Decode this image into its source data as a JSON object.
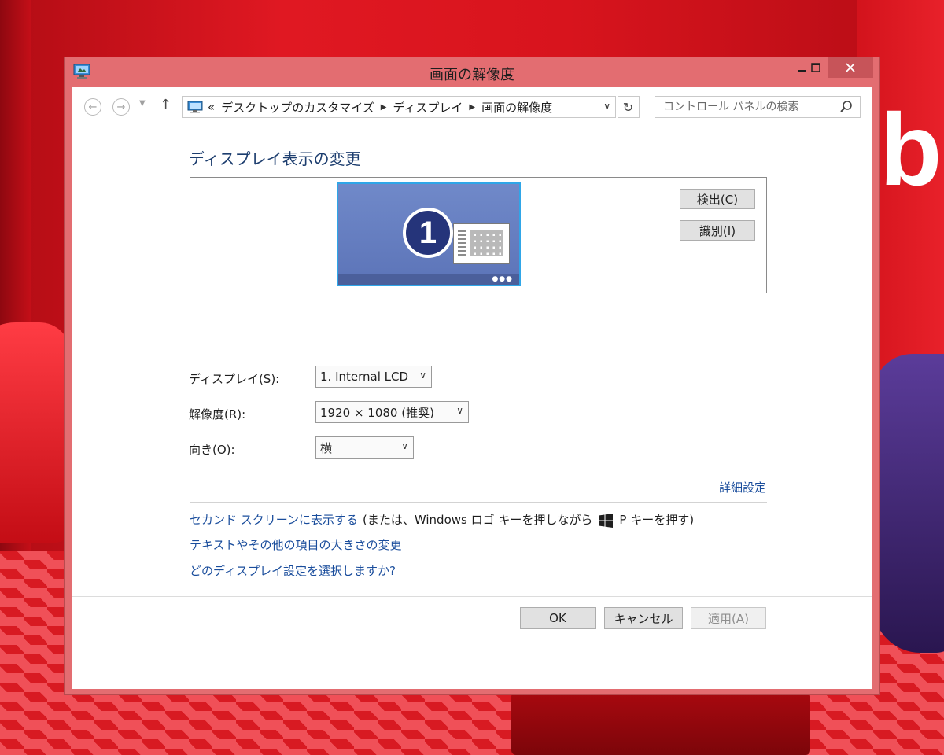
{
  "window": {
    "title": "画面の解像度",
    "controls": {
      "minimize": "—",
      "maximize": "☐",
      "close": "✕"
    }
  },
  "navigation": {
    "address_prefix": "«",
    "breadcrumbs": [
      "デスクトップのカスタマイズ",
      "ディスプレイ",
      "画面の解像度"
    ],
    "search_placeholder": "コントロール パネルの検索"
  },
  "content": {
    "heading": "ディスプレイ表示の変更",
    "monitor_number": "1",
    "detect_button": "検出(C)",
    "identify_button": "識別(I)",
    "display_label": "ディスプレイ(S):",
    "display_value": "1. Internal LCD",
    "resolution_label": "解像度(R):",
    "resolution_value": "1920 × 1080 (推奨)",
    "orientation_label": "向き(O):",
    "orientation_value": "横",
    "advanced_link": "詳細設定",
    "second_screen_link": "セカンド スクリーンに表示する",
    "second_screen_hint_before": "(または、Windows ロゴ キーを押しながら",
    "second_screen_hint_after": "P キーを押す)",
    "text_size_link": "テキストやその他の項目の大きさの変更",
    "which_settings_link": "どのディスプレイ設定を選択しますか?"
  },
  "buttons": {
    "ok": "OK",
    "cancel": "キャンセル",
    "apply": "適用(A)"
  },
  "colors": {
    "window_frame": "#e36d71",
    "link": "#1a4d9c",
    "heading": "#1c3d6e",
    "monitor_fill": "#5c74b8"
  }
}
